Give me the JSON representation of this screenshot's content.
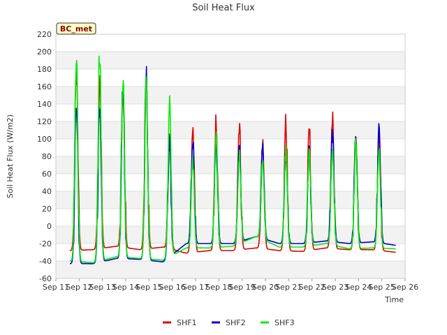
{
  "chart_data": {
    "type": "line",
    "title": "Soil Heat Flux",
    "xlabel": "Time",
    "ylabel": "Soil Heat Flux (W/m2)",
    "ylim": [
      -60,
      220
    ],
    "yticks": [
      -60,
      -40,
      -20,
      0,
      20,
      40,
      60,
      80,
      100,
      120,
      140,
      160,
      180,
      200,
      220
    ],
    "xlim": [
      0,
      15
    ],
    "xtick_labels": [
      "Sep 11",
      "Sep 12",
      "Sep 13",
      "Sep 14",
      "Sep 15",
      "Sep 16",
      "Sep 17",
      "Sep 18",
      "Sep 19",
      "Sep 20",
      "Sep 21",
      "Sep 22",
      "Sep 23",
      "Sep 24",
      "Sep 25",
      "Sep 26"
    ],
    "grid": true,
    "legend_position": "bottom",
    "annotation": "BC_met",
    "days": [
      "Sep 11",
      "Sep 12",
      "Sep 13",
      "Sep 14",
      "Sep 15",
      "Sep 16",
      "Sep 17",
      "Sep 18",
      "Sep 19",
      "Sep 20",
      "Sep 21",
      "Sep 22",
      "Sep 23",
      "Sep 24"
    ],
    "series": [
      {
        "name": "SHF1",
        "color": "#dd0000",
        "baseline": [
          -28,
          -27,
          -23,
          -27,
          -24,
          -31,
          -28,
          -28,
          -25,
          -28,
          -29,
          -25,
          -27,
          -27
        ],
        "peak": [
          178,
          175,
          162,
          168,
          100,
          113,
          118,
          114,
          103,
          121,
          116,
          122,
          105,
          111
        ],
        "end_value": -30
      },
      {
        "name": "SHF2",
        "color": "#0000cc",
        "baseline": [
          -43,
          -43,
          -37,
          -38,
          -41,
          -20,
          -20,
          -20,
          -12,
          -20,
          -20,
          -17,
          -20,
          -18
        ],
        "peak": [
          145,
          140,
          162,
          168,
          100,
          100,
          97,
          90,
          90,
          85,
          85,
          107,
          104,
          110
        ],
        "end_value": -22
      },
      {
        "name": "SHF3",
        "color": "#00ee00",
        "baseline": [
          -40,
          -42,
          -35,
          -37,
          -39,
          -25,
          -25,
          -23,
          -12,
          -24,
          -24,
          -20,
          -26,
          -25
        ],
        "peak": [
          191,
          199,
          172,
          158,
          147,
          75,
          110,
          85,
          80,
          85,
          90,
          95,
          100,
          85
        ],
        "end_value": -26
      }
    ]
  }
}
